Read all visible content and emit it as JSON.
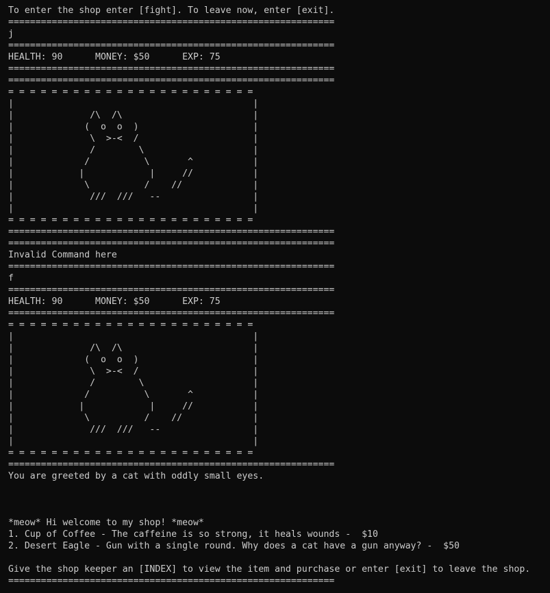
{
  "terminal": {
    "lines": [
      "To enter the shop enter [fight]. To leave now, enter [exit].",
      "============================================================",
      "j",
      "============================================================",
      "HEALTH: 90      MONEY: $50      EXP: 75",
      "============================================================",
      "============================================================",
      "= = = = = = = = = = = = = = = = = = = = = = =",
      "|                                            |",
      "|              /\\  /\\                        |",
      "|             (  o  o  )                     |",
      "|              \\  >-<  /                     |",
      "|              /        \\                    |",
      "|             /          \\       ^           |",
      "|            |            |     //           |",
      "|             \\          /    //             |",
      "|              ///  ///   --                 |",
      "|                                            |",
      "= = = = = = = = = = = = = = = = = = = = = = =",
      "============================================================",
      "============================================================",
      "Invalid Command here",
      "============================================================",
      "f",
      "============================================================",
      "HEALTH: 90      MONEY: $50      EXP: 75",
      "============================================================",
      "= = = = = = = = = = = = = = = = = = = = = = =",
      "|                                            |",
      "|              /\\  /\\                        |",
      "|             (  o  o  )                     |",
      "|              \\  >-<  /                     |",
      "|              /        \\                    |",
      "|             /          \\       ^           |",
      "|            |            |     //           |",
      "|             \\          /    //             |",
      "|              ///  ///   --                 |",
      "|                                            |",
      "= = = = = = = = = = = = = = = = = = = = = = =",
      "============================================================",
      "You are greeted by a cat with oddly small eyes.",
      "",
      "",
      "",
      "*meow* Hi welcome to my shop! *meow*",
      "1. Cup of Coffee - The caffeine is so strong, it heals wounds -  $10",
      "2. Desert Eagle - Gun with a single round. Why does a cat have a gun anyway? -  $50",
      "",
      "Give the shop keeper an [INDEX] to view the item and purchase or enter [exit] to leave the shop.",
      "============================================================"
    ]
  }
}
